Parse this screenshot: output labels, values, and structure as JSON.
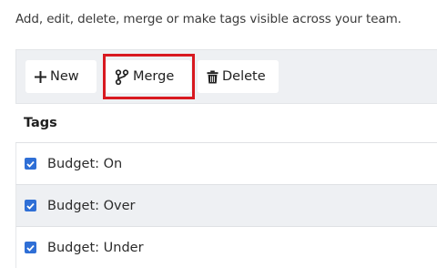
{
  "description": "Add, edit, delete, merge or make tags visible across your team.",
  "toolbar": {
    "new_label": "New",
    "merge_label": "Merge",
    "delete_label": "Delete"
  },
  "table": {
    "header": "Tags",
    "rows": [
      {
        "label": "Budget: On",
        "checked": true
      },
      {
        "label": "Budget: Over",
        "checked": true
      },
      {
        "label": "Budget: Under",
        "checked": true
      }
    ]
  },
  "colors": {
    "highlight": "#d81920",
    "checkbox": "#2f6fd6",
    "toolbar_bg": "#eef0f3"
  },
  "icons": {
    "new": "plus-icon",
    "merge": "merge-branch-icon",
    "delete": "trash-icon",
    "row_check": "checkbox-checked-icon"
  }
}
